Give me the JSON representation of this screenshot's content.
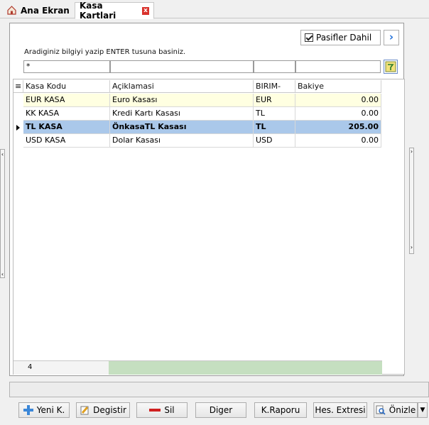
{
  "tabs": [
    {
      "label": "Ana Ekran",
      "active": false
    },
    {
      "label": "Kasa Kartlari",
      "active": true
    }
  ],
  "filter": {
    "pasif_label": "Pasifler Dahil",
    "pasif_checked": true,
    "hint": "Aradiginiz bilgiyi yazip ENTER tusuna basiniz.",
    "inputs": [
      "*",
      "",
      "",
      ""
    ]
  },
  "grid": {
    "columns": [
      "Kasa Kodu",
      "Açiklamasi",
      "BIRIM-",
      "Bakiye"
    ],
    "rows": [
      {
        "code": "EUR KASA",
        "desc": "Euro Kasası",
        "unit": "EUR",
        "balance": "0.00",
        "state": "alt"
      },
      {
        "code": "KK KASA",
        "desc": "Kredi Kartı Kasası",
        "unit": "TL",
        "balance": "0.00",
        "state": "normal"
      },
      {
        "code": "TL KASA",
        "desc": "ÖnkasaTL Kasası",
        "unit": "TL",
        "balance": "205.00",
        "state": "selected"
      },
      {
        "code": "USD KASA",
        "desc": "Dolar Kasası",
        "unit": "USD",
        "balance": "0.00",
        "state": "normal"
      }
    ],
    "footer_count": "4"
  },
  "buttons": {
    "new": "Yeni K.",
    "edit": "Degistir",
    "delete": "Sil",
    "other": "Diger",
    "report": "K.Raporu",
    "statement": "Hes. Extresi",
    "preview": "Önizle"
  },
  "colors": {
    "alt_row": "#ffffe1",
    "selected_row": "#aac8ea",
    "footer_green": "#c5dfc0",
    "accent": "#1e6fd9"
  }
}
